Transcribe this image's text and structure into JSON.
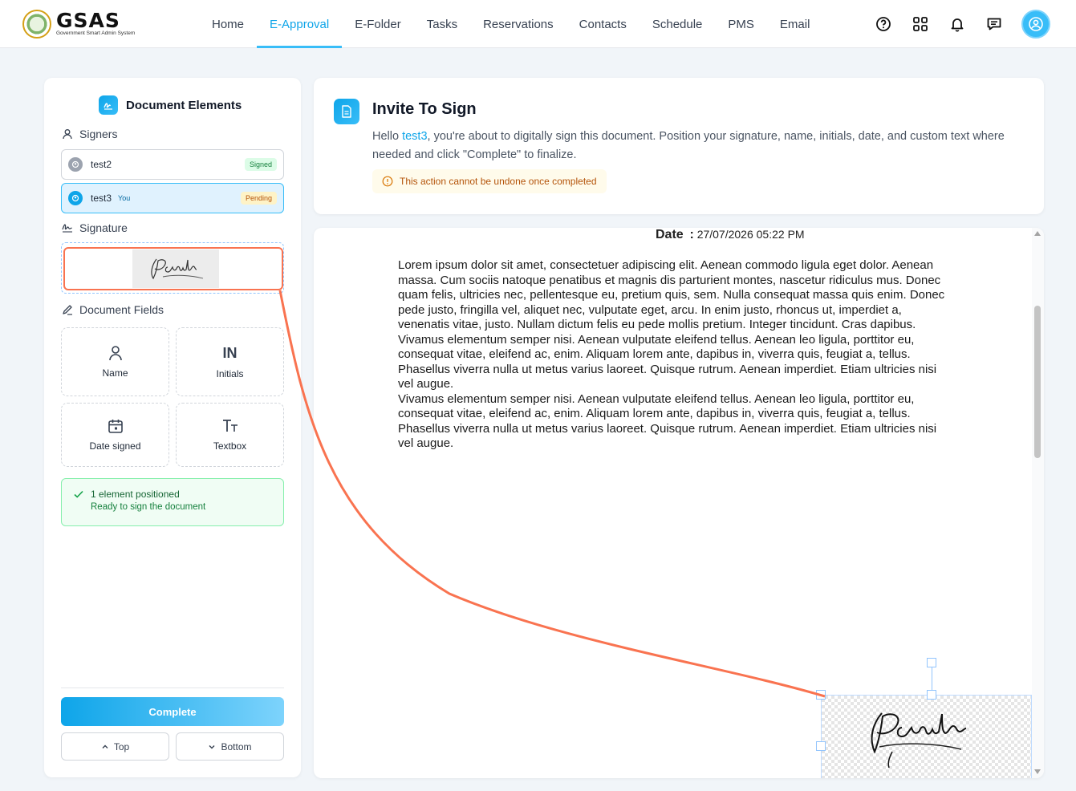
{
  "header": {
    "logo_title": "GSAS",
    "logo_subtitle": "Government Smart Admin System",
    "nav": [
      {
        "label": "Home",
        "active": false
      },
      {
        "label": "E-Approval",
        "active": true
      },
      {
        "label": "E-Folder",
        "active": false
      },
      {
        "label": "Tasks",
        "active": false
      },
      {
        "label": "Reservations",
        "active": false
      },
      {
        "label": "Contacts",
        "active": false
      },
      {
        "label": "Schedule",
        "active": false
      },
      {
        "label": "PMS",
        "active": false
      },
      {
        "label": "Email",
        "active": false
      }
    ],
    "icons": [
      "help-icon",
      "apps-grid-icon",
      "bell-icon",
      "chat-icon",
      "user-avatar-icon"
    ]
  },
  "left_panel": {
    "title": "Document Elements",
    "signers_label": "Signers",
    "signers": [
      {
        "name": "test2",
        "you": "",
        "status": "Signed"
      },
      {
        "name": "test3",
        "you": "You",
        "status": "Pending"
      }
    ],
    "signature_label": "Signature",
    "fields_label": "Document Fields",
    "fields": [
      {
        "label": "Name",
        "icon": "user-icon"
      },
      {
        "label": "Initials",
        "icon": "initials-icon",
        "glyph": "IN"
      },
      {
        "label": "Date signed",
        "icon": "calendar-icon"
      },
      {
        "label": "Textbox",
        "icon": "text-icon"
      }
    ],
    "status_title": "1 element positioned",
    "status_sub": "Ready to sign the document",
    "complete_label": "Complete",
    "top_label": "Top",
    "bottom_label": "Bottom"
  },
  "invite": {
    "title": "Invite To Sign",
    "text_before": "Hello ",
    "user": "test3",
    "text_after": ", you're about to digitally sign this document. Position your signature, name, initials, date, and custom text where needed and click \"Complete\" to finalize.",
    "warning": "This action cannot be undone once completed"
  },
  "document": {
    "date_label": "Date",
    "date_sep": ":",
    "date_value": "27/07/2026 05:22 PM",
    "body": "Lorem ipsum dolor sit amet, consectetuer adipiscing elit. Aenean commodo ligula eget dolor. Aenean massa. Cum sociis natoque penatibus et magnis dis parturient montes, nascetur ridiculus mus. Donec quam felis, ultricies nec, pellentesque eu, pretium quis, sem. Nulla consequat massa quis enim. Donec pede justo, fringilla vel, aliquet nec, vulputate eget, arcu. In enim justo, rhoncus ut, imperdiet a, venenatis vitae, justo. Nullam dictum felis eu pede mollis pretium. Integer tincidunt. Cras dapibus. Vivamus elementum semper nisi. Aenean vulputate eleifend tellus. Aenean leo ligula, porttitor eu, consequat vitae, eleifend ac, enim. Aliquam lorem ante, dapibus in, viverra quis, feugiat a, tellus. Phasellus viverra nulla ut metus varius laoreet. Quisque rutrum. Aenean imperdiet. Etiam ultricies nisi vel augue.",
    "body2": "Vivamus elementum semper nisi. Aenean vulputate eleifend tellus. Aenean leo ligula, porttitor eu, consequat vitae, eleifend ac, enim. Aliquam lorem ante, dapibus in, viverra quis, feugiat a, tellus. Phasellus viverra nulla ut metus varius laoreet. Quisque rutrum. Aenean imperdiet. Etiam ultricies nisi vel augue."
  },
  "colors": {
    "accent": "#0ea5e9",
    "connector": "#f97350",
    "signed": "#15803d",
    "pending": "#b45309"
  }
}
